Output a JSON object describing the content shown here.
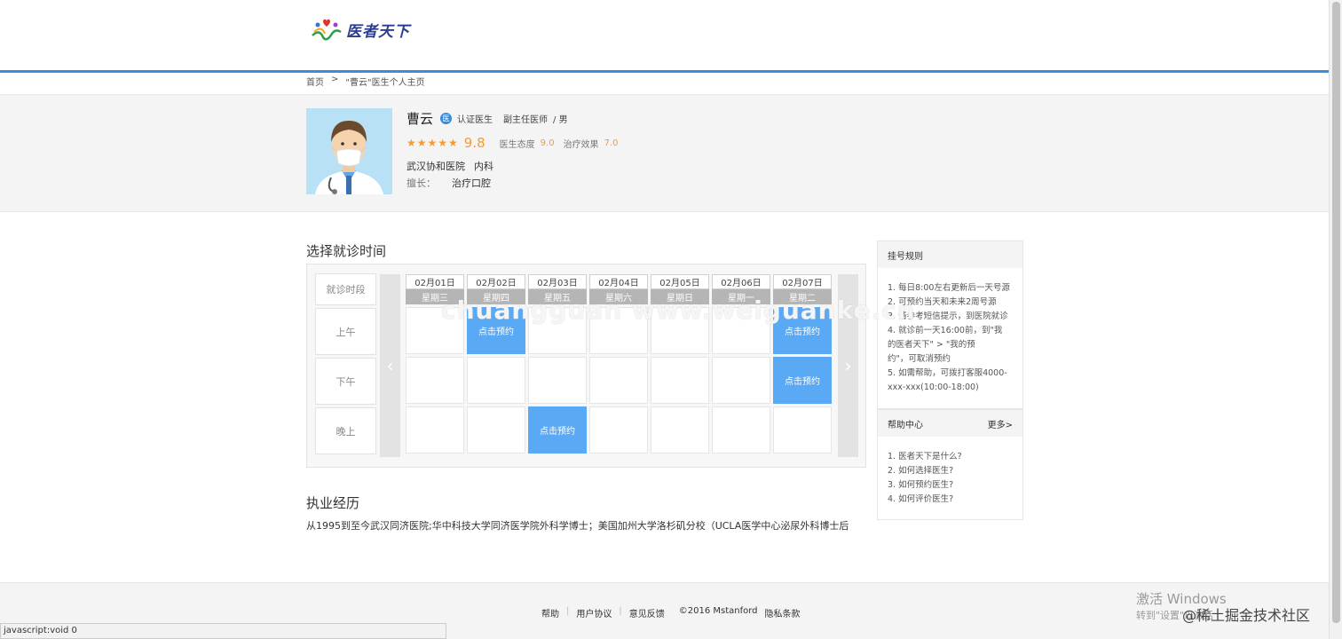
{
  "logo": {
    "text": "医者天下"
  },
  "breadcrumb": {
    "home": "首页",
    "separator": ">",
    "current": "\"曹云\"医生个人主页"
  },
  "doctor": {
    "name": "曹云",
    "cert_icon_char": "医",
    "cert_label": "认证医生",
    "title": "副主任医师",
    "gender": "/ 男",
    "stars": "★★★★★",
    "rating": "9.8",
    "attitude_label": "医生态度",
    "attitude_value": "9.0",
    "effect_label": "治疗效果",
    "effect_value": "7.0",
    "hospital": "武汉协和医院",
    "department": "内科",
    "specialty_label": "擅长：",
    "specialty": "治疗口腔"
  },
  "schedule": {
    "title": "选择就诊时间",
    "slot_header": "就诊时段",
    "slots": [
      "上午",
      "下午",
      "晚上"
    ],
    "prev_icon": "‹",
    "next_icon": "›",
    "book_label": "点击预约",
    "days": [
      {
        "date": "02月01日",
        "weekday": "星期三",
        "am": false,
        "pm": false,
        "eve": false
      },
      {
        "date": "02月02日",
        "weekday": "星期四",
        "am": true,
        "pm": false,
        "eve": false
      },
      {
        "date": "02月03日",
        "weekday": "星期五",
        "am": false,
        "pm": false,
        "eve": true
      },
      {
        "date": "02月04日",
        "weekday": "星期六",
        "am": false,
        "pm": false,
        "eve": false
      },
      {
        "date": "02月05日",
        "weekday": "星期日",
        "am": false,
        "pm": false,
        "eve": false
      },
      {
        "date": "02月06日",
        "weekday": "星期一",
        "am": false,
        "pm": false,
        "eve": false
      },
      {
        "date": "02月07日",
        "weekday": "星期二",
        "am": true,
        "pm": true,
        "eve": false
      }
    ]
  },
  "career": {
    "title": "执业经历",
    "text": "从1995到至今武汉同济医院;华中科技大学同济医学院外科学博士；美国加州大学洛杉矶分校（UCLA医学中心泌尿外科博士后"
  },
  "rules": {
    "title": "挂号规则",
    "items": [
      "1. 每日8:00左右更新后一天号源",
      "2. 可预约当天和未来2周号源",
      "3. 请参考短信提示，到医院就诊",
      "4. 就诊前一天16:00前，到\"我",
      "的医者天下\" > \"我的预",
      "约\"，可取消预约",
      "5. 如需帮助，可拨打客服4000-",
      "xxx-xxx(10:00-18:00)"
    ]
  },
  "help": {
    "title": "帮助中心",
    "more": "更多>",
    "items": [
      "1. 医者天下是什么?",
      "2. 如何选择医生?",
      "3. 如何预约医生?",
      "4. 如何评价医生?"
    ]
  },
  "footer": {
    "links": [
      "帮助",
      "用户协议",
      "意见反馈"
    ],
    "copyright": "©2016 Mstanford",
    "privacy": "隐私条款"
  },
  "overlays": {
    "watermark": "chuangguan www.weiguanke.cn",
    "windows_activate": "激活 Windows",
    "windows_activate_sub": "转到\"设置\"以激活",
    "juejin": "@稀土掘金技术社区",
    "status": "javascript:void 0"
  }
}
